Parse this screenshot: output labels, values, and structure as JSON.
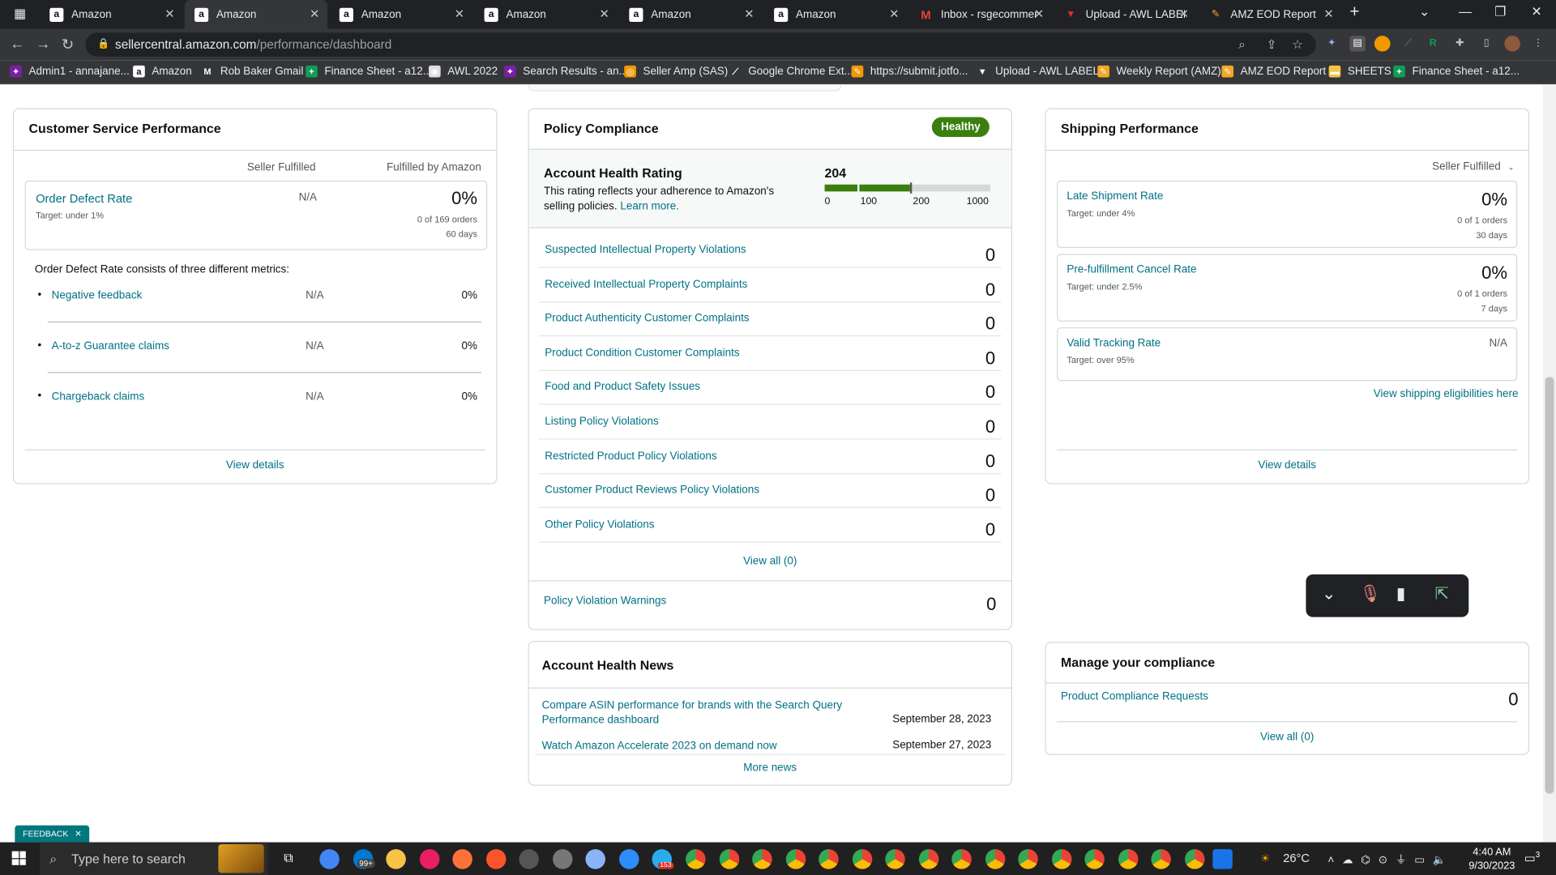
{
  "browser": {
    "tabs": [
      {
        "label": "Amazon",
        "icon": "amazon-icon"
      },
      {
        "label": "Amazon",
        "icon": "amazon-icon",
        "active": true
      },
      {
        "label": "Amazon",
        "icon": "amazon-icon"
      },
      {
        "label": "Amazon",
        "icon": "amazon-icon"
      },
      {
        "label": "Amazon",
        "icon": "amazon-icon"
      },
      {
        "label": "Amazon",
        "icon": "amazon-icon"
      },
      {
        "label": "Inbox - rsgecommer",
        "icon": "gmail-icon"
      },
      {
        "label": "Upload - AWL LABEL",
        "icon": "awl-icon"
      },
      {
        "label": "AMZ EOD Report",
        "icon": "eod-icon"
      }
    ],
    "url_host": "sellercentral.amazon.com",
    "url_path": "/performance/dashboard",
    "bookmarks": [
      {
        "label": "Admin1 - annajane...",
        "icon": "admin-icon"
      },
      {
        "label": "Amazon",
        "icon": "amazon-icon"
      },
      {
        "label": "Rob Baker Gmail",
        "icon": "gmail-icon"
      },
      {
        "label": "Finance Sheet - a12...",
        "icon": "sheets-icon"
      },
      {
        "label": "AWL 2022",
        "icon": "globe-icon"
      },
      {
        "label": "Search Results - an...",
        "icon": "search-results-icon"
      },
      {
        "label": "Seller Amp (SAS)",
        "icon": "selleramp-icon"
      },
      {
        "label": "Google Chrome Ext...",
        "icon": "chrome-ext-icon"
      },
      {
        "label": "https://submit.jotfo...",
        "icon": "jotform-icon"
      },
      {
        "label": "Upload - AWL LABEL",
        "icon": "awl-icon"
      },
      {
        "label": "Weekly Report (AMZ)",
        "icon": "report-icon"
      },
      {
        "label": "AMZ EOD Report",
        "icon": "eod-icon"
      },
      {
        "label": "SHEETS",
        "icon": "folder-icon"
      },
      {
        "label": "Finance Sheet - a12...",
        "icon": "sheets-icon"
      }
    ]
  },
  "customer_service": {
    "title": "Customer Service Performance",
    "col_seller": "Seller Fulfilled",
    "col_fba": "Fulfilled by Amazon",
    "odr_label": "Order Defect Rate",
    "odr_target": "Target: under 1%",
    "odr_seller": "N/A",
    "odr_value": "0%",
    "odr_orders": "0 of 169 orders",
    "odr_days": "60 days",
    "intro": "Order Defect Rate consists of three different metrics:",
    "metrics": [
      {
        "label": "Negative feedback",
        "seller": "N/A",
        "fba": "0%"
      },
      {
        "label": "A-to-z Guarantee claims",
        "seller": "N/A",
        "fba": "0%"
      },
      {
        "label": "Chargeback claims",
        "seller": "N/A",
        "fba": "0%"
      }
    ],
    "view_details": "View details"
  },
  "policy": {
    "title": "Policy Compliance",
    "badge": "Healthy",
    "ahr_title": "Account Health Rating",
    "ahr_desc": "This rating reflects your adherence to Amazon's selling policies.",
    "learn_more": "Learn more.",
    "score": "204",
    "scale": [
      "0",
      "100",
      "200",
      "1000"
    ],
    "rows": [
      {
        "label": "Suspected Intellectual Property Violations",
        "value": "0"
      },
      {
        "label": "Received Intellectual Property Complaints",
        "value": "0"
      },
      {
        "label": "Product Authenticity Customer Complaints",
        "value": "0"
      },
      {
        "label": "Product Condition Customer Complaints",
        "value": "0"
      },
      {
        "label": "Food and Product Safety Issues",
        "value": "0"
      },
      {
        "label": "Listing Policy Violations",
        "value": "0"
      },
      {
        "label": "Restricted Product Policy Violations",
        "value": "0"
      },
      {
        "label": "Customer Product Reviews Policy Violations",
        "value": "0"
      },
      {
        "label": "Other Policy Violations",
        "value": "0"
      }
    ],
    "view_all": "View all (0)",
    "warnings_label": "Policy Violation Warnings",
    "warnings_value": "0",
    "colors": {
      "healthy": "#3b7f0f",
      "bar_empty": "#d5d9d9"
    }
  },
  "news": {
    "title": "Account Health News",
    "items": [
      {
        "text": "Compare ASIN performance for brands with the Search Query Performance dashboard",
        "date": "September 28, 2023"
      },
      {
        "text": "Watch Amazon Accelerate 2023 on demand now",
        "date": "September 27, 2023"
      }
    ],
    "more": "More news"
  },
  "shipping": {
    "title": "Shipping Performance",
    "filter": "Seller Fulfilled",
    "items": [
      {
        "label": "Late Shipment Rate",
        "target": "Target: under 4%",
        "value": "0%",
        "orders": "0 of 1 orders",
        "days": "30 days"
      },
      {
        "label": "Pre-fulfillment Cancel Rate",
        "target": "Target: under 2.5%",
        "value": "0%",
        "orders": "0 of 1 orders",
        "days": "7 days"
      },
      {
        "label": "Valid Tracking Rate",
        "target": "Target: over 95%",
        "value": "N/A"
      }
    ],
    "eligibility": "View shipping eligibilities here",
    "view_details": "View details"
  },
  "compliance": {
    "title": "Manage your compliance",
    "row_label": "Product Compliance Requests",
    "row_value": "0",
    "view_all": "View all (0)"
  },
  "feedback": "FEEDBACK",
  "taskbar": {
    "search_placeholder": "Type here to search",
    "weather": "26°C",
    "time": "4:40 AM",
    "date": "9/30/2023",
    "notification_count": "3",
    "mail_badge": "99+",
    "telegram_badge": "153"
  }
}
